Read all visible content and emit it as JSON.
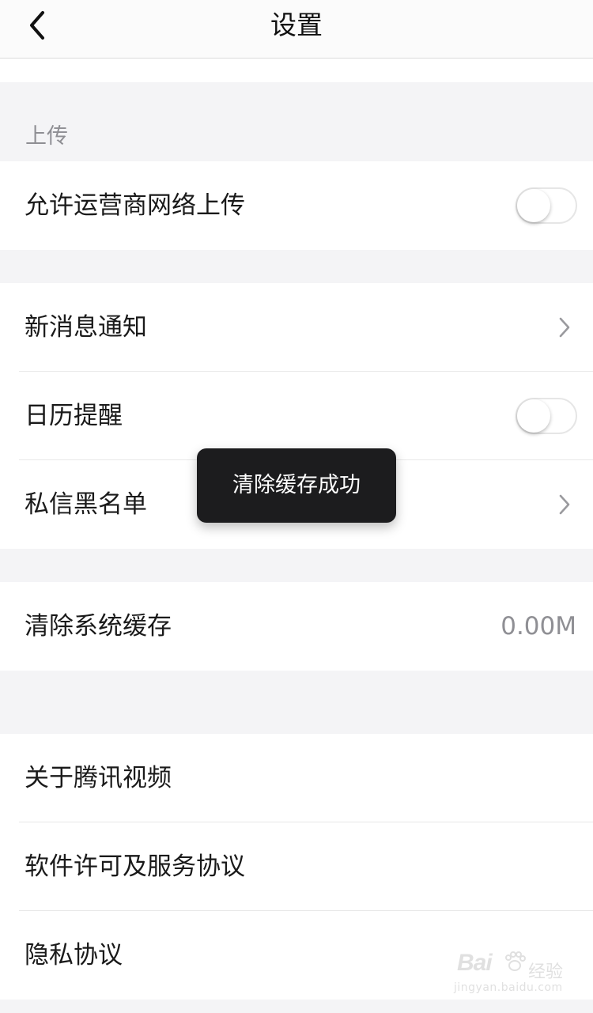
{
  "nav": {
    "title": "设置",
    "back_icon": "chevron-left-icon"
  },
  "upload_section": {
    "label": "上传",
    "rows": [
      {
        "label": "允许运营商网络上传",
        "control": "toggle",
        "on": false
      }
    ]
  },
  "notify_section": {
    "rows": [
      {
        "label": "新消息通知",
        "control": "chevron"
      },
      {
        "label": "日历提醒",
        "control": "toggle",
        "on": false
      },
      {
        "label": "私信黑名单",
        "control": "chevron"
      }
    ]
  },
  "cache_section": {
    "rows": [
      {
        "label": "清除系统缓存",
        "value": "0.00M"
      }
    ]
  },
  "about_section": {
    "rows": [
      {
        "label": "关于腾讯视频"
      },
      {
        "label": "软件许可及服务协议"
      },
      {
        "label": "隐私协议"
      }
    ]
  },
  "toast": {
    "message": "清除缓存成功"
  },
  "watermark": {
    "brand": "Bai",
    "brand_cn": "经验",
    "url": "jingyan.baidu.com"
  },
  "colors": {
    "background": "#f4f4f6",
    "secondary_text": "#8f8f94",
    "toast_bg": "#1c1c1e"
  }
}
